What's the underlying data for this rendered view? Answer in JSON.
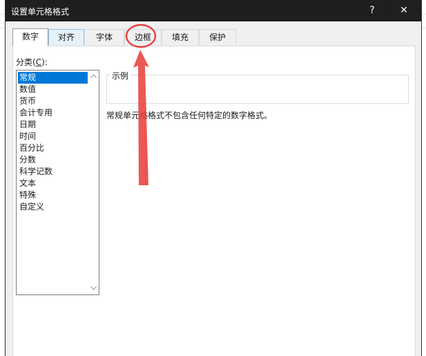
{
  "dialog": {
    "title": "设置单元格格式",
    "help_glyph": "?",
    "close_glyph": "✕"
  },
  "tabs": [
    {
      "label": "数字",
      "active": true
    },
    {
      "label": "对齐",
      "active": false
    },
    {
      "label": "字体",
      "active": false
    },
    {
      "label": "边框",
      "active": false
    },
    {
      "label": "填充",
      "active": false
    },
    {
      "label": "保护",
      "active": false
    }
  ],
  "category": {
    "label_prefix": "分类(",
    "label_hotkey": "C",
    "label_suffix": "):",
    "items": [
      "常规",
      "数值",
      "货币",
      "会计专用",
      "日期",
      "时间",
      "百分比",
      "分数",
      "科学记数",
      "文本",
      "特殊",
      "自定义"
    ],
    "selected_index": 0
  },
  "sample": {
    "legend": "示例",
    "value": ""
  },
  "description": "常规单元格格式不包含任何特定的数字格式。",
  "colors": {
    "titlebar": "#1f1f1f",
    "selection": "#0078d7",
    "annotation": "#e8423f"
  },
  "icons": {
    "scroll_up": "chevron-up-icon",
    "scroll_down": "chevron-down-icon"
  }
}
